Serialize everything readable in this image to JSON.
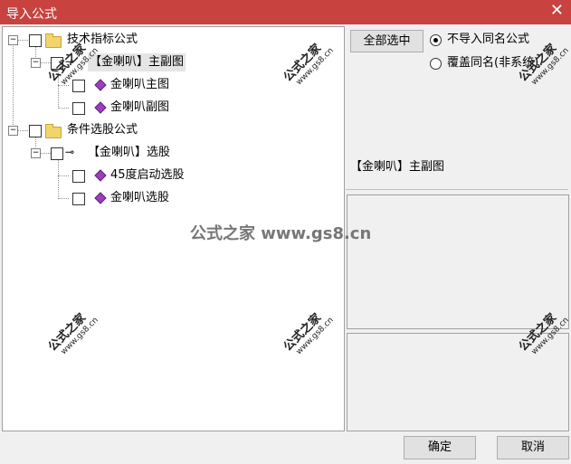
{
  "window": {
    "title": "导入公式",
    "close": "✕"
  },
  "tree": {
    "group1": {
      "label": "技术指标公式",
      "expander": "−"
    },
    "item1": {
      "label": "【金喇叭】主副图",
      "expander": "−"
    },
    "item1_children": [
      "金喇叭主图",
      "金喇叭副图"
    ],
    "group2": {
      "label": "条件选股公式",
      "expander": "−"
    },
    "item2": {
      "label": "【金喇叭】选股",
      "expander": "−"
    },
    "item2_children": [
      "45度启动选股",
      "金喇叭选股"
    ]
  },
  "toolbar": {
    "select_all": "全部选中"
  },
  "options": {
    "no_import_same_name": "不导入同名公式",
    "overwrite_same_name": "覆盖同名(非系统)",
    "selected": "no_import_same_name"
  },
  "info": {
    "selected_formula": "【金喇叭】主副图"
  },
  "footer": {
    "ok": "确定",
    "cancel": "取消"
  },
  "watermark": {
    "site_name": "公式之家",
    "site_url": "www.gs8.cn",
    "center": "公式之家 www.gs8.cn"
  },
  "colors": {
    "titlebar": "#c8433f",
    "gem": "#9b3fbf",
    "folder": "#f2d46a"
  }
}
